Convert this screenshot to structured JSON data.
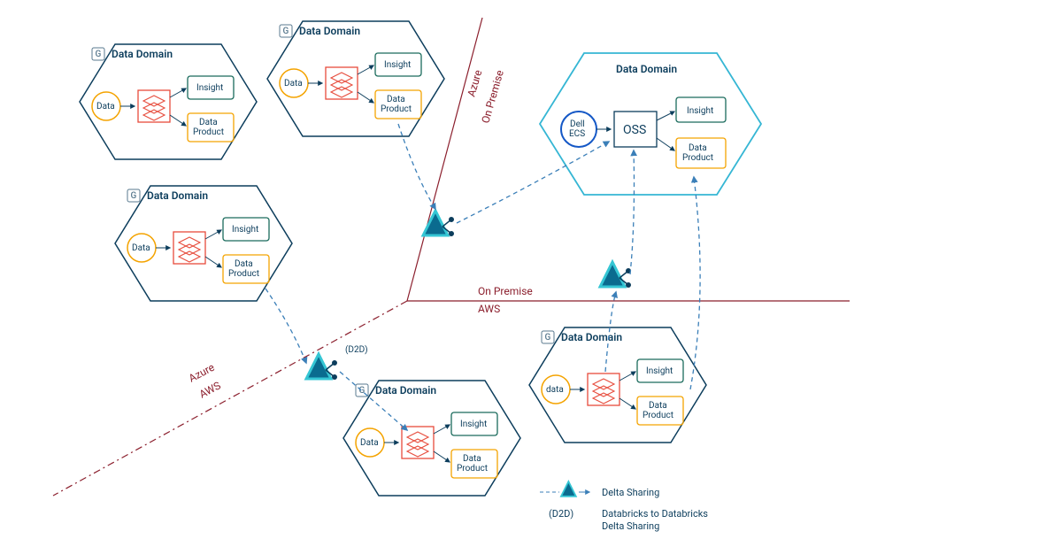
{
  "domains": [
    {
      "title": "Data Domain",
      "g": "G",
      "data": "Data",
      "insight": "Insight",
      "product": "Data\nProduct"
    },
    {
      "title": "Data Domain",
      "g": "G",
      "data": "Data",
      "insight": "Insight",
      "product": "Data\nProduct"
    },
    {
      "title": "Data Domain",
      "g": "G",
      "data": "Data",
      "insight": "Insight",
      "product": "Data\nProduct"
    },
    {
      "title": "Data Domain",
      "g": "G",
      "data": "Data",
      "insight": "Insight",
      "product": "Data\nProduct"
    },
    {
      "title": "Data Domain",
      "g": "G",
      "data": "data",
      "insight": "Insight",
      "product": "Data\nProduct"
    }
  ],
  "oss": {
    "title": "Data Domain",
    "dell": "Dell\nECS",
    "oss": "OSS",
    "insight": "Insight",
    "product": "Data\nProduct"
  },
  "annotations": {
    "d2d": "(D2D)"
  },
  "regions": {
    "azure_onprem_a": "Azure",
    "azure_onprem_b": "On Premise",
    "onprem_aws_a": "On Premise",
    "onprem_aws_b": "AWS",
    "azure_aws_a": "Azure",
    "azure_aws_b": "AWS"
  },
  "legend": {
    "delta": "Delta Sharing",
    "d2d_tag": "(D2D)",
    "d2d_text": "Databricks to Databricks\nDelta Sharing"
  }
}
